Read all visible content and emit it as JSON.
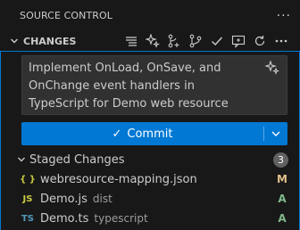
{
  "header": {
    "title": "SOURCE CONTROL",
    "more": "···"
  },
  "changes": {
    "label": "CHANGES",
    "actions": [
      "view-as-list-icon",
      "generate-message-sparkle-icon",
      "commit-graph-icon",
      "branch-icon",
      "check-icon",
      "pull-request-icon",
      "refresh-icon",
      "more-actions-icon"
    ]
  },
  "commit_message": {
    "value": "Implement OnLoad, OnSave, and OnChange event handlers in TypeScript for Demo web resource"
  },
  "commit_button": {
    "label": "Commit",
    "check_glyph": "✓"
  },
  "staged": {
    "label": "Staged Changes",
    "count": "3",
    "files": [
      {
        "icon": "{ }",
        "icon_color": "#cbcb41",
        "name": "webresource-mapping.json",
        "dir": "",
        "status": "M",
        "status_color": "#e2c08d"
      },
      {
        "icon": "JS",
        "icon_color": "#cbcb41",
        "name": "Demo.js",
        "dir": "dist",
        "status": "A",
        "status_color": "#81b88b"
      },
      {
        "icon": "TS",
        "icon_color": "#519aba",
        "name": "Demo.ts",
        "dir": "typescript",
        "status": "A",
        "status_color": "#81b88b"
      }
    ]
  },
  "colors": {
    "accent": "#0078d4",
    "background": "#181818",
    "modified": "#e2c08d",
    "added": "#81b88b"
  }
}
